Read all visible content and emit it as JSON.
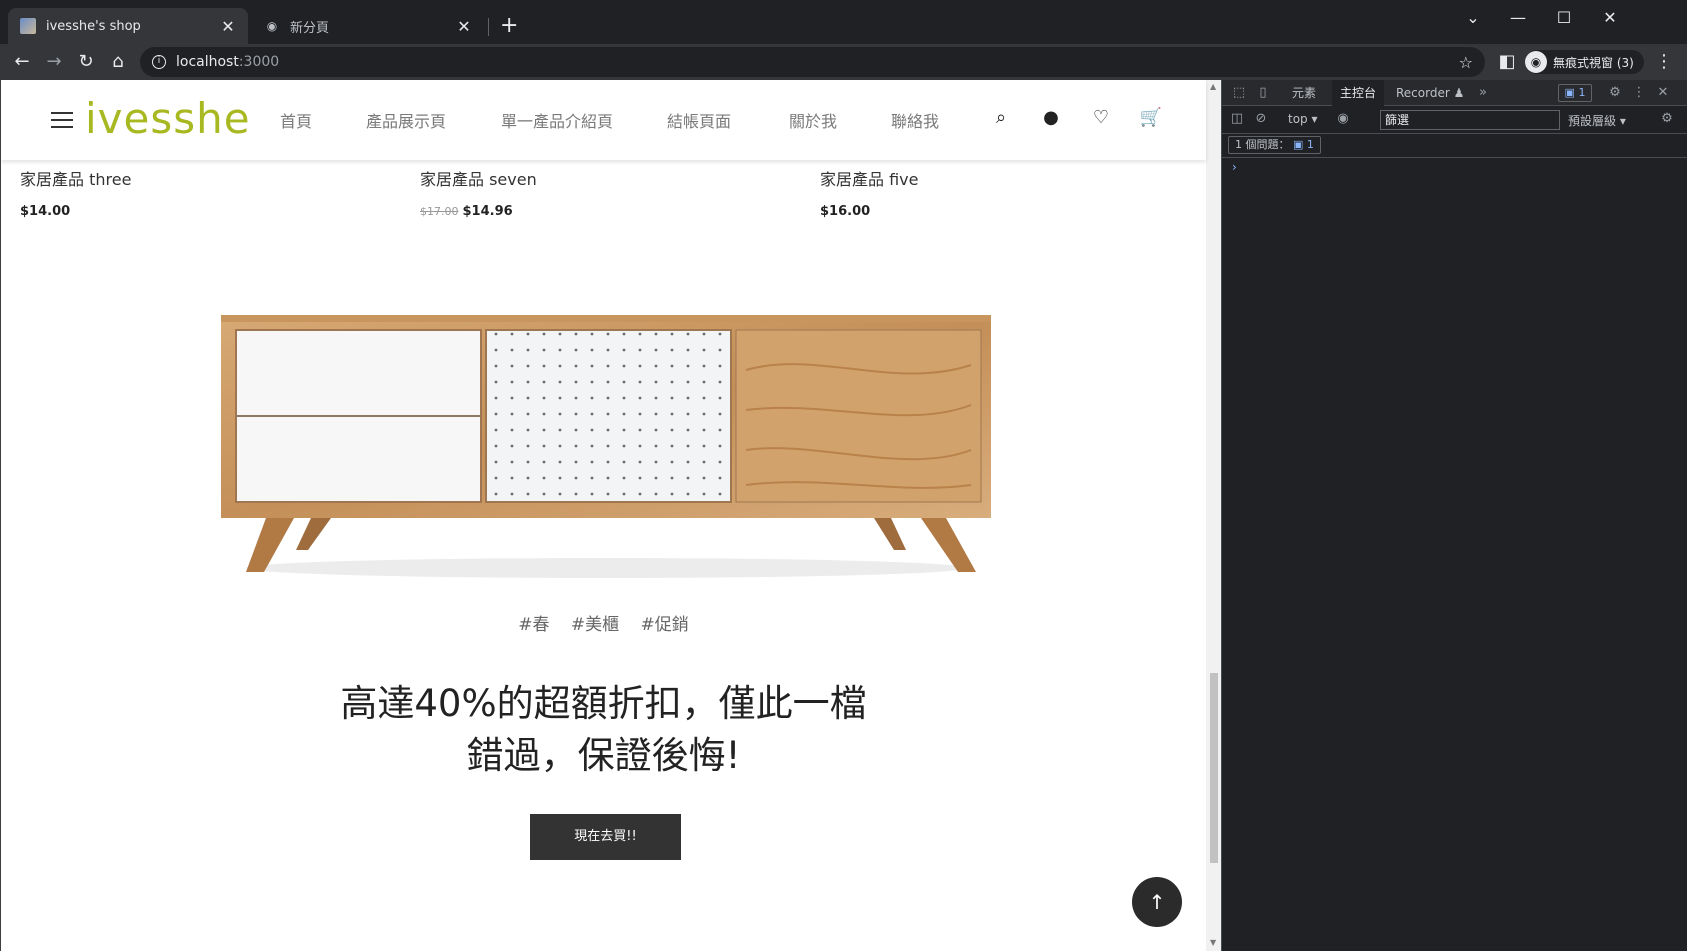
{
  "browser": {
    "tabs": [
      {
        "title": "ivesshe's shop",
        "active": true
      },
      {
        "title": "新分頁",
        "active": false
      }
    ],
    "address_host": "localhost",
    "address_port": ":3000",
    "incognito_label": "無痕式視窗 (3)"
  },
  "site": {
    "logo": "ivesshe",
    "nav": [
      "首頁",
      "產品展示頁",
      "單一產品介紹頁",
      "結帳頁面",
      "關於我",
      "聯絡我"
    ],
    "products": [
      {
        "name": "家居產品 three",
        "old_price": "",
        "price": "$14.00"
      },
      {
        "name": "家居產品 seven",
        "old_price": "$17.00",
        "price": "$14.96"
      },
      {
        "name": "家居產品 five",
        "old_price": "",
        "price": "$16.00"
      }
    ],
    "tags": [
      "#春",
      "#美櫃",
      "#促銷"
    ],
    "headline_line1": "高達40%的超額折扣，僅此一檔",
    "headline_line2": "錯過，保證後悔!",
    "cta": "現在去買!!",
    "back_to_top": "↑"
  },
  "devtools": {
    "tabs": [
      "元素",
      "主控台",
      "Recorder ♟"
    ],
    "active_tab": "主控台",
    "issues_badge": "1",
    "context_select": "top ▾",
    "filter_value": "篩選",
    "levels_select": "預設層級 ▾",
    "issues_label": "1 個問題：",
    "issues_count": "1",
    "prompt": "›"
  }
}
